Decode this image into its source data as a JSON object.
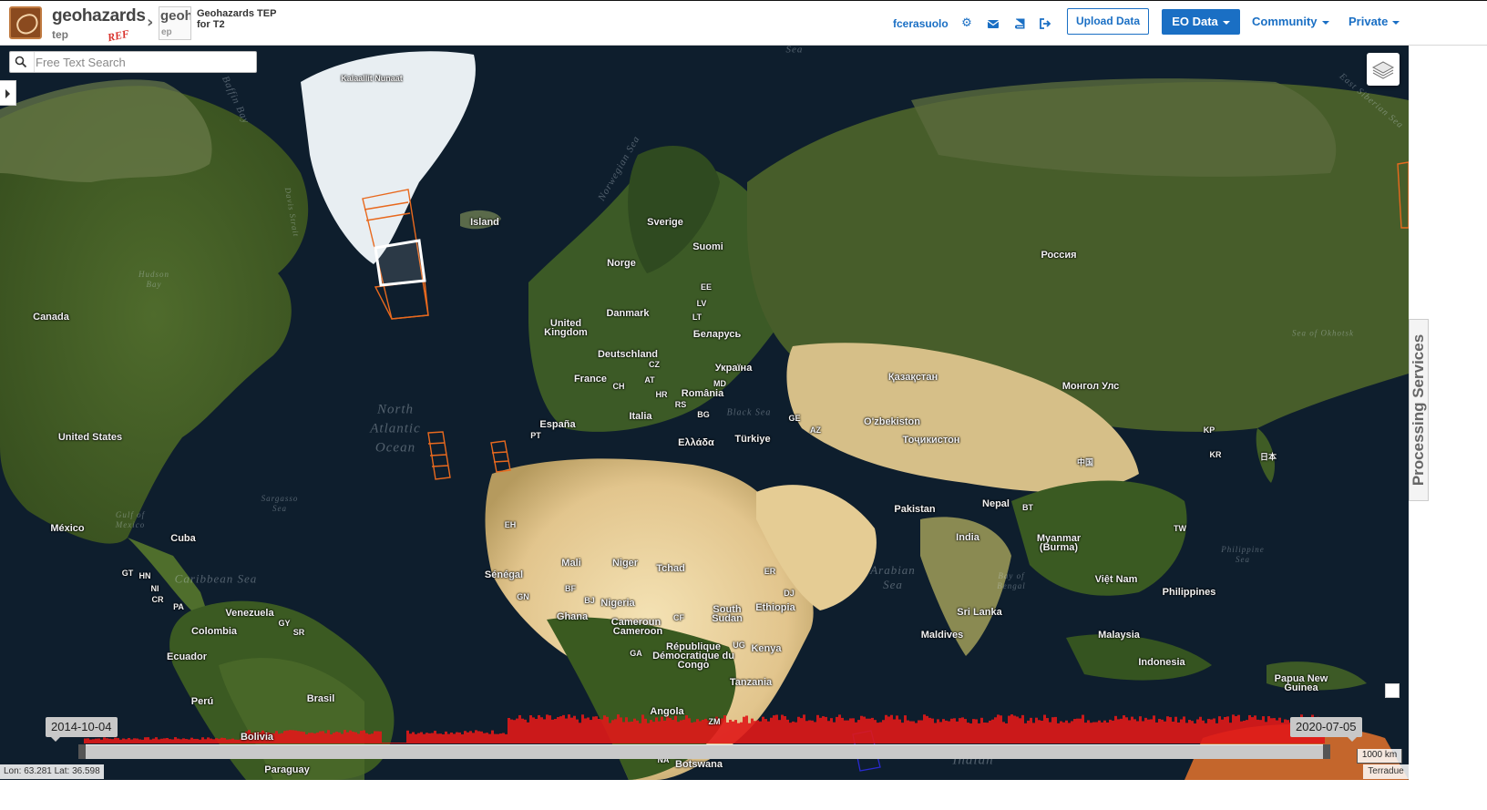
{
  "header": {
    "brand_name": "geohazards",
    "brand_sub": "tep",
    "brand_tag": "REF",
    "sub_logo_top": "geoha",
    "sub_logo_bottom": "ep",
    "title_line1": "Geohazards TEP",
    "title_line2": "for T2",
    "username": "fcerasuolo",
    "icons": [
      "gear-icon",
      "envelope-icon",
      "book-icon",
      "sign-out-icon"
    ],
    "upload_label": "Upload Data",
    "eo_label": "EO Data",
    "community_label": "Community",
    "private_label": "Private",
    "accent": "#1a6fc4"
  },
  "search": {
    "placeholder": "Free Text Search",
    "value": ""
  },
  "map": {
    "labels": {
      "kalaallit": "Kalaallit Nunaat",
      "island": "Island",
      "sverige": "Sverige",
      "suomi": "Suomi",
      "norge": "Norge",
      "rossiya": "Россия",
      "canada": "Canada",
      "ee": "EE",
      "lv": "LV",
      "lt": "LT",
      "danmark": "Danmark",
      "uk": "United Kingdom",
      "belarus": "Беларусь",
      "deutschland": "Deutschland",
      "cz": "CZ",
      "ukraina": "Україна",
      "france": "France",
      "at": "AT",
      "md": "MD",
      "ch": "CH",
      "hr": "HR",
      "romania": "România",
      "rs": "RS",
      "kazakhstan": "Қазақстан",
      "mongol": "Монгол Улс",
      "espana": "España",
      "pt": "PT",
      "italia": "Italia",
      "bg": "BG",
      "ge": "GE",
      "az": "AZ",
      "uzbekiston": "O'zbekiston",
      "kp": "KP",
      "turkiye": "Türkiye",
      "ellada": "Ελλάδα",
      "tojikiston": "Тоҷикистон",
      "kr": "KR",
      "nihon": "日本",
      "zhongguo": "中国",
      "us": "United States",
      "pakistan": "Pakistan",
      "nepal": "Nepal",
      "bt": "BT",
      "mexico": "México",
      "india": "India",
      "myanmar": "Myanmar (Burma)",
      "tw": "TW",
      "cuba": "Cuba",
      "mali": "Mali",
      "niger": "Niger",
      "tchad": "Tchad",
      "senegal": "Sénégal",
      "gt": "GT",
      "hn": "HN",
      "ni": "NI",
      "cr": "CR",
      "pa": "PA",
      "gn": "GN",
      "bf": "BF",
      "bj": "BJ",
      "nigeria": "Nigeria",
      "er": "ER",
      "dj": "DJ",
      "vietnam": "Việt Nam",
      "philippines": "Philippines",
      "venezuela": "Venezuela",
      "gy": "GY",
      "sr": "SR",
      "ghana": "Ghana",
      "cameroun": "Cameroun",
      "cameroon": "Cameroon",
      "cf": "CF",
      "south_sudan": "South Sudan",
      "ethiopia": "Ethiopia",
      "sri_lanka": "Sri Lanka",
      "colombia": "Colombia",
      "maldives": "Maldives",
      "malaysia": "Malaysia",
      "ecuador": "Ecuador",
      "rdc": "République Démocratique du Congo",
      "ug": "UG",
      "kenya": "Kenya",
      "ga": "GA",
      "indonesia": "Indonesia",
      "tanzania": "Tanzania",
      "papua": "Papua New Guinea",
      "peru": "Perú",
      "brasil": "Brasil",
      "angola": "Angola",
      "bolivia": "Bolivia",
      "zm": "ZM",
      "na": "NA",
      "botswana": "Botswana",
      "paraguay": "Paraguay",
      "eh": "EH"
    },
    "oceans": {
      "north_atlantic": "North Atlantic Ocean",
      "indian": "Indian",
      "arabian_sea": "Arabian Sea",
      "caribbean": "Caribbean Sea",
      "baffin_bay": "Baffin Bay",
      "norwegian_sea": "Norwegian Sea",
      "black_sea": "Black Sea",
      "gulf_mexico": "Gulf of Mexico",
      "sargasso": "Sargasso Sea",
      "hudson_bay": "Hudson Bay",
      "sea_okhotsk": "Sea of Okhotsk",
      "east_siberian": "East Siberian Sea",
      "philippine_sea": "Philippine Sea",
      "bay_bengal": "Bay of Bengal",
      "davis_strait": "Davis Strait",
      "sea_top": "Sea"
    },
    "footprint_colors": {
      "product": "#e8691e",
      "selected": "#ffffff",
      "other": "#2a2ad0"
    }
  },
  "timeline": {
    "start_date": "2014-10-04",
    "end_date": "2020-07-05",
    "histogram_color": "#e01818"
  },
  "status": {
    "coords": "Lon: 63.281 Lat: 36.598",
    "scale": "1000 km",
    "attribution": "Terradue"
  },
  "right_panel": {
    "processing_services": "Processing Services"
  }
}
